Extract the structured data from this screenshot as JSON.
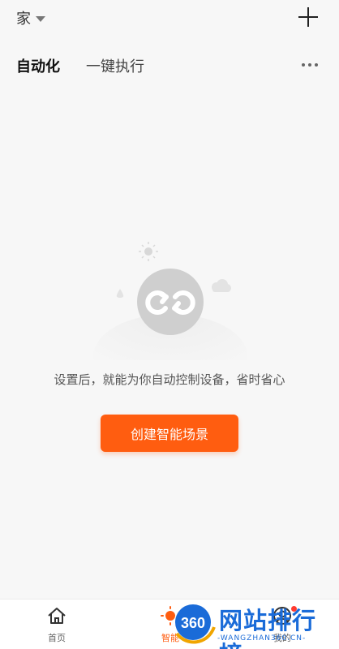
{
  "header": {
    "home_name": "家",
    "add_icon": "plus-icon"
  },
  "tabs": [
    {
      "label": "自动化",
      "active": true
    },
    {
      "label": "一键执行",
      "active": false
    }
  ],
  "more_icon": "ellipsis-icon",
  "empty_state": {
    "icon": "loop-icon",
    "message": "设置后，就能为你自动控制设备，省时省心",
    "cta_label": "创建智能场景"
  },
  "bottom_nav": [
    {
      "label": "首页",
      "icon": "home-icon"
    },
    {
      "label": "智能",
      "icon": "sun-icon",
      "active": true
    },
    {
      "label": "我的",
      "icon": "user-icon"
    }
  ],
  "watermark": {
    "logo": "360",
    "text": "网站排行榜",
    "sub": "-WANGZHAN360.CN-"
  },
  "colors": {
    "accent": "#ff5d10",
    "background": "#f7f7f7",
    "watermark": "#1a6bd8"
  }
}
